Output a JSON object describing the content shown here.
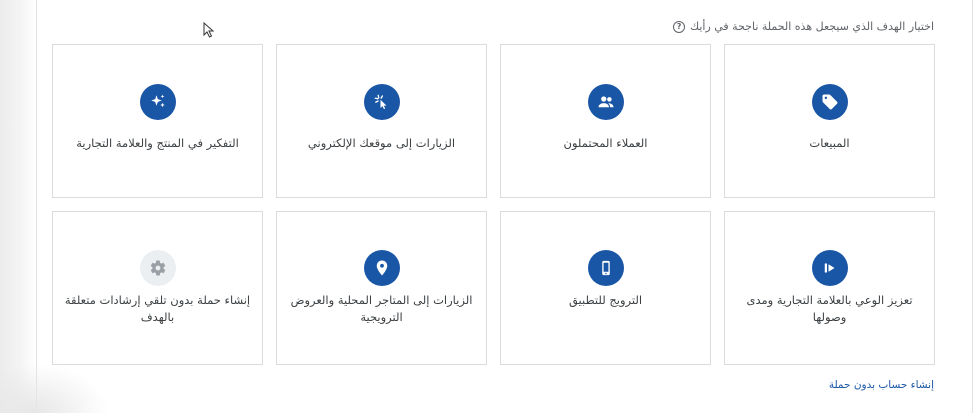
{
  "header": {
    "question": "اختيار الهدف الذي سيجعل هذه الحملة ناجحة في رأيك",
    "help_icon": "question-circle-icon"
  },
  "goals": [
    {
      "label": "المبيعات",
      "icon": "tag-icon"
    },
    {
      "label": "العملاء المحتملون",
      "icon": "people-icon"
    },
    {
      "label": "الزيارات إلى موقعك الإلكتروني",
      "icon": "cursor-click-icon"
    },
    {
      "label": "التفكير في المنتج والعلامة التجارية",
      "icon": "sparkle-icon"
    },
    {
      "label": "تعزيز الوعي بالعلامة التجارية ومدى وصولها",
      "icon": "megaphone-icon"
    },
    {
      "label": "الترويج للتطبيق",
      "icon": "phone-icon"
    },
    {
      "label": "الزيارات إلى المتاجر المحلية والعروض الترويجية",
      "icon": "location-pin-icon"
    },
    {
      "label": "إنشاء حملة بدون تلقي إرشادات متعلقة بالهدف",
      "icon": "gear-icon"
    }
  ],
  "footer": {
    "link": "إنشاء حساب بدون حملة"
  },
  "colors": {
    "accent": "#1a56a6",
    "border": "#dadce0",
    "text": "#3c4043",
    "muted": "#5f6368"
  }
}
